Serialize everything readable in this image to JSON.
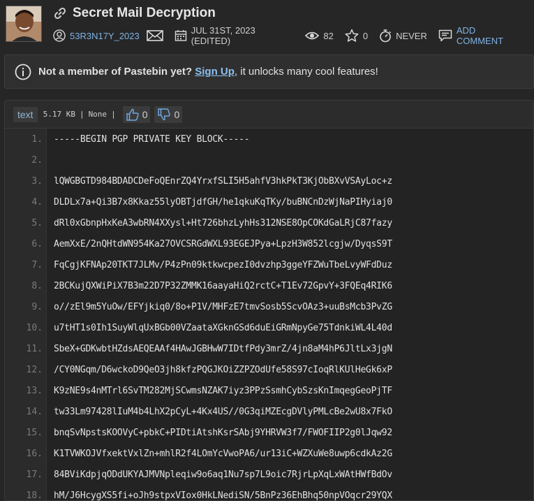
{
  "paste": {
    "title": "Secret Mail Decryption",
    "author": "53R3N17Y_2023",
    "date": "JUL 31ST, 2023 (EDITED)",
    "views": "82",
    "stars": "0",
    "expiry": "NEVER",
    "add_comment": "ADD COMMENT"
  },
  "notice": {
    "lead": "Not a member of Pastebin yet?",
    "signup": "Sign Up",
    "rest": ", it unlocks many cool features!"
  },
  "toolbar": {
    "language": "text",
    "size": "5.17 KB",
    "category": "None",
    "likes": "0",
    "dislikes": "0"
  },
  "lines": [
    {
      "n": "1.",
      "t": "-----BEGIN PGP PRIVATE KEY BLOCK-----"
    },
    {
      "n": "2.",
      "t": ""
    },
    {
      "n": "3.",
      "t": "lQWGBGTD984BDADCDeFoQEnrZQ4YrxfSLI5H5ahfV3hkPkT3KjObBXvVSAyLoc+z"
    },
    {
      "n": "4.",
      "t": "DLDLx7a+Qi3B7x8Kkaz55lyOBTjdfGH/he1qkuKqTKy/buBNCnDzWjNaPIHyiaj0"
    },
    {
      "n": "5.",
      "t": "dRl0xGbnpHxKeA3wbRN4XXysl+Ht726bhzLyhHs312NSE8OpCOKdGaLRjC87fazy"
    },
    {
      "n": "6.",
      "t": "AemXxE/2nQHtdWN954Ka27OVCSRGdWXL93EGEJPya+LpzH3W852lcgjw/DyqsS9T"
    },
    {
      "n": "7.",
      "t": "FqCgjKFNAp20TKT7JLMv/P4zPn09ktkwcpezI0dvzhp3ggeYFZWuTbeLvyWFdDuz"
    },
    {
      "n": "8.",
      "t": "2BCKujQXWiPiX7B3m22D7P32ZMMK16aayaHiQ2rctC+T1Ev72GpvY+3FQEq4RIK6"
    },
    {
      "n": "9.",
      "t": "o//zEl9m5YuOw/EFYjkiq0/8o+P1V/MHFzE7tmvSosb5ScvOAz3+uuBsMcb3PvZG"
    },
    {
      "n": "10.",
      "t": "u7tHT1s0Ih1SuyWlqUxBGb00VZaataXGknGSd6duEiGRmNpyGe75TdnkiWL4L40d"
    },
    {
      "n": "11.",
      "t": "SbeX+GDKwbtHZdsAEQEAAf4HAwJGBHwW7IDtfPdy3mrZ/4jn8aM4hP6JltLx3jgN"
    },
    {
      "n": "12.",
      "t": "/CY0NGqm/D6wckoD9QeO3jh8kfzPQGJKOiZZPZOdUfe58S97cIoqRlKUlHeGk6xP"
    },
    {
      "n": "13.",
      "t": "K9zNE9s4nMTrl6SvTM282MjSCwmsNZAK7iyz3PPzSsmhCybSzsKnImqegGeoPjTF"
    },
    {
      "n": "14.",
      "t": "tw33Lm97428lIuM4b4LhX2pCyL+4Kx4US//0G3qiMZEcgDVlyPMLcBe2wU8x7FkO"
    },
    {
      "n": "15.",
      "t": "bnqSvNpstsKOOVyC+pbkC+PIDtiAtshKsrSAbj9YHRVW3f7/FWOFIIP2g0lJqw92"
    },
    {
      "n": "16.",
      "t": "K1TVWKOJVfxektVxlZn+mhlR2f4LOmYcVwoPA6/ur13iC+WZXuWe8uwp6cdkAz2G"
    },
    {
      "n": "17.",
      "t": "84BViKdpjqODdUKYAJMVNpleqiw9o6aq1Nu7sp7L9oic7RjrLpXqLxWAtHWfBdOv"
    },
    {
      "n": "18.",
      "t": "hM/J6HcygXS5fi+oJh9stpxVIox0HkLNediSN/5BnPz36EhBhq50npVOqcr29YQX"
    }
  ]
}
